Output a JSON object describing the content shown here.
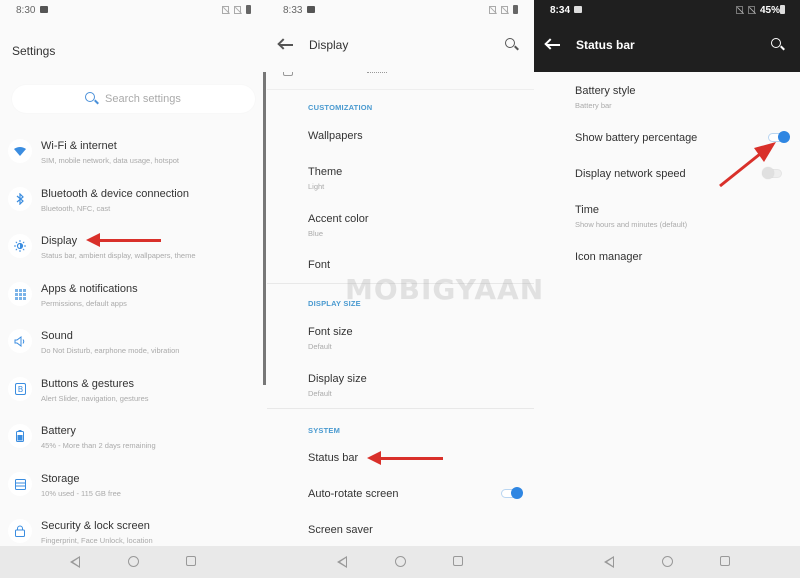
{
  "panels": {
    "settings": {
      "status": {
        "time": "8:30"
      },
      "title": "Settings",
      "search_placeholder": "Search settings",
      "items": [
        {
          "title": "Wi-Fi & internet",
          "subtitle": "SIM, mobile network, data usage, hotspot",
          "icon": "wifi-icon"
        },
        {
          "title": "Bluetooth & device connection",
          "subtitle": "Bluetooth, NFC, cast",
          "icon": "bluetooth-icon"
        },
        {
          "title": "Display",
          "subtitle": "Status bar, ambient display, wallpapers, theme",
          "icon": "brightness-icon"
        },
        {
          "title": "Apps & notifications",
          "subtitle": "Permissions, default apps",
          "icon": "apps-grid-icon"
        },
        {
          "title": "Sound",
          "subtitle": "Do Not Disturb, earphone mode, vibration",
          "icon": "speaker-icon"
        },
        {
          "title": "Buttons & gestures",
          "subtitle": "Alert Slider, navigation, gestures",
          "icon": "button-b-icon"
        },
        {
          "title": "Battery",
          "subtitle": "45% - More than 2 days remaining",
          "icon": "battery-icon"
        },
        {
          "title": "Storage",
          "subtitle": "10% used - 115 GB free",
          "icon": "storage-icon"
        },
        {
          "title": "Security & lock screen",
          "subtitle": "Fingerprint, Face Unlock, location",
          "icon": "lock-icon"
        }
      ]
    },
    "display": {
      "status": {
        "time": "8:33"
      },
      "title": "Display",
      "sections": {
        "customization": "CUSTOMIZATION",
        "display_size": "DISPLAY SIZE",
        "system": "SYSTEM"
      },
      "items": {
        "wallpapers": {
          "title": "Wallpapers"
        },
        "theme": {
          "title": "Theme",
          "subtitle": "Light"
        },
        "accent": {
          "title": "Accent color",
          "subtitle": "Blue"
        },
        "font": {
          "title": "Font"
        },
        "font_size": {
          "title": "Font size",
          "subtitle": "Default"
        },
        "display_size": {
          "title": "Display size",
          "subtitle": "Default"
        },
        "status_bar": {
          "title": "Status bar"
        },
        "auto_rotate": {
          "title": "Auto-rotate screen",
          "enabled": true
        },
        "screen_saver": {
          "title": "Screen saver"
        }
      }
    },
    "status_bar": {
      "status": {
        "time": "8:34",
        "battery_pct": "45%"
      },
      "title": "Status bar",
      "items": {
        "battery_style": {
          "title": "Battery style",
          "subtitle": "Battery bar"
        },
        "show_battery_pct": {
          "title": "Show battery percentage",
          "enabled": true
        },
        "network_speed": {
          "title": "Display network speed",
          "enabled": false
        },
        "time": {
          "title": "Time",
          "subtitle": "Show hours and minutes (default)"
        },
        "icon_manager": {
          "title": "Icon manager"
        }
      }
    }
  },
  "watermark": "MOBIGYAAN",
  "colors": {
    "accent": "#2f86e2",
    "section": "#4a9ad0",
    "annotation_arrow": "#d9302a",
    "dark_header": "#1f1f1f"
  }
}
